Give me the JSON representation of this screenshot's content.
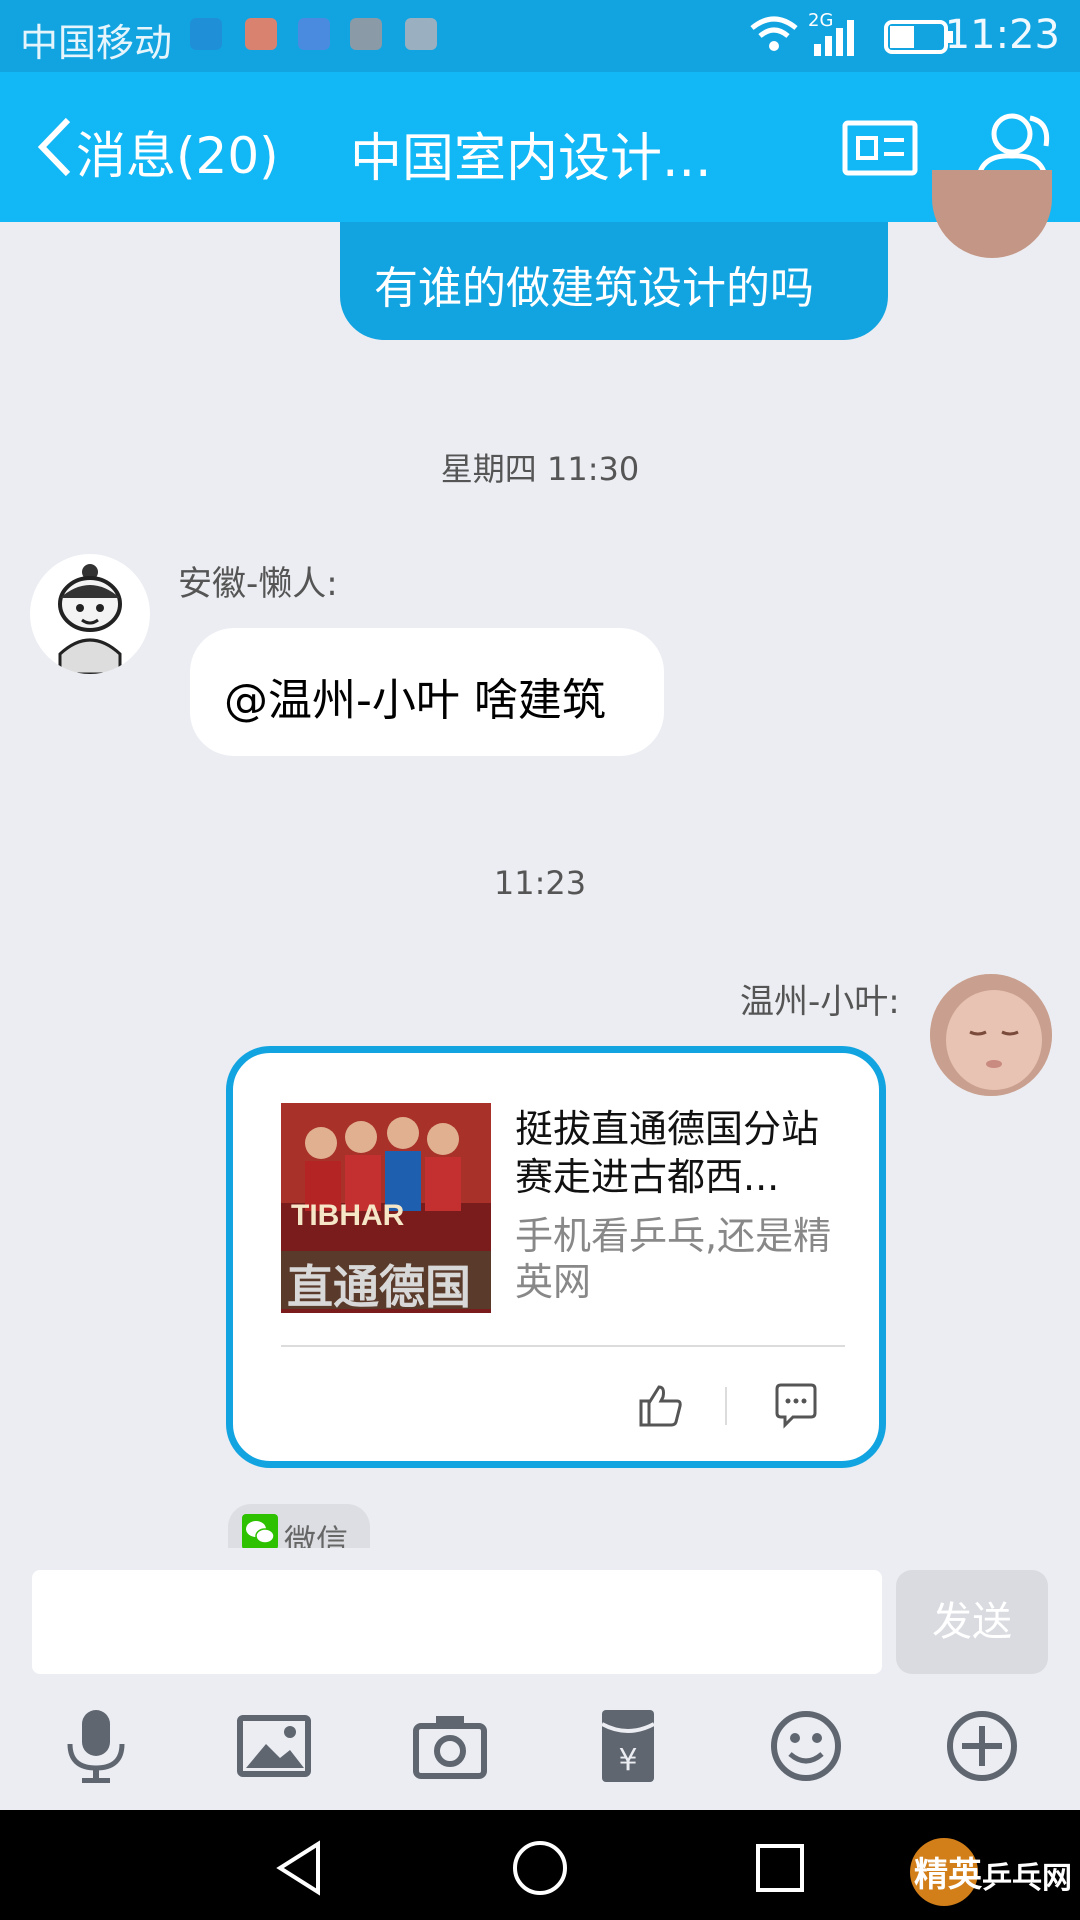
{
  "status_bar": {
    "carrier": "中国移动",
    "network": "2G",
    "time": "11:23"
  },
  "header": {
    "back_label": "消息(20)",
    "title": "中国室内设计..."
  },
  "messages": {
    "outgoing_text": "有谁的做建筑设计的吗",
    "timestamp_1": "星期四 11:30",
    "incoming_sender": "安徽-懒人:",
    "incoming_text": "@温州-小叶 啥建筑",
    "timestamp_2": "11:23",
    "share_sender": "温州-小叶:"
  },
  "share_card": {
    "thumbnail_text": "TIBHAR",
    "thumbnail_caption": "直通德国",
    "title": "挺拔直通德国分站赛走进古都西...",
    "description": "手机看乒乓,还是精英网",
    "source_label": "微信"
  },
  "input_bar": {
    "placeholder": "",
    "send_label": "发送"
  },
  "watermark": {
    "site": "精英乒乓网"
  },
  "colors": {
    "brand_blue": "#12b7f5",
    "bubble_blue": "#12a4e1",
    "background": "#ebedf2"
  }
}
